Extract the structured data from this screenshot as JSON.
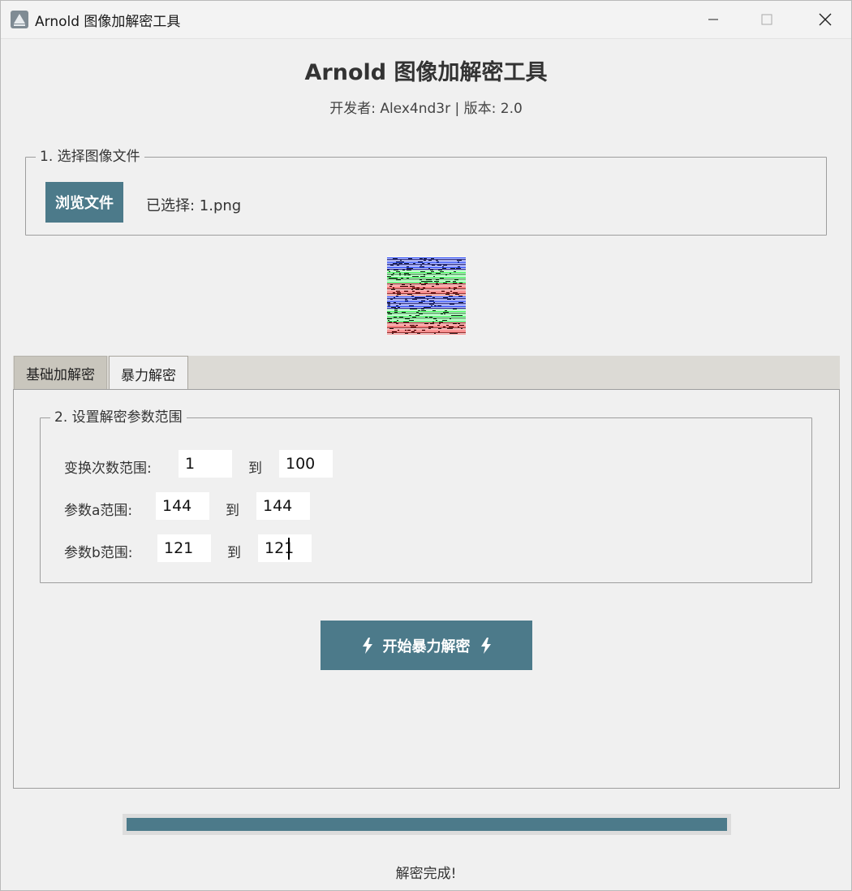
{
  "window": {
    "title": "Arnold 图像加解密工具",
    "icon": "app-triangle-icon"
  },
  "header": {
    "title": "Arnold 图像加解密工具",
    "subtitle": "开发者: Alex4nd3r | 版本: 2.0"
  },
  "file_section": {
    "legend": "1. 选择图像文件",
    "browse_label": "浏览文件",
    "selected_text": "已选择: 1.png"
  },
  "tabs": [
    {
      "label": "基础加解密",
      "active": false
    },
    {
      "label": "暴力解密",
      "active": true
    }
  ],
  "brute_section": {
    "legend": "2. 设置解密参数范围",
    "to_label": "到",
    "rows": [
      {
        "label": "变换次数范围:",
        "from": "1",
        "to": "100"
      },
      {
        "label": "参数a范围:",
        "from": "144",
        "to": "144"
      },
      {
        "label": "参数b范围:",
        "from": "121",
        "to": "121"
      }
    ],
    "start_label": "开始暴力解密",
    "start_icon": "lightning-icon"
  },
  "progress": {
    "value": 1.0
  },
  "status_text": "解密完成!",
  "colors": {
    "accent": "#4c7a8a",
    "background": "#f0f0f0"
  }
}
